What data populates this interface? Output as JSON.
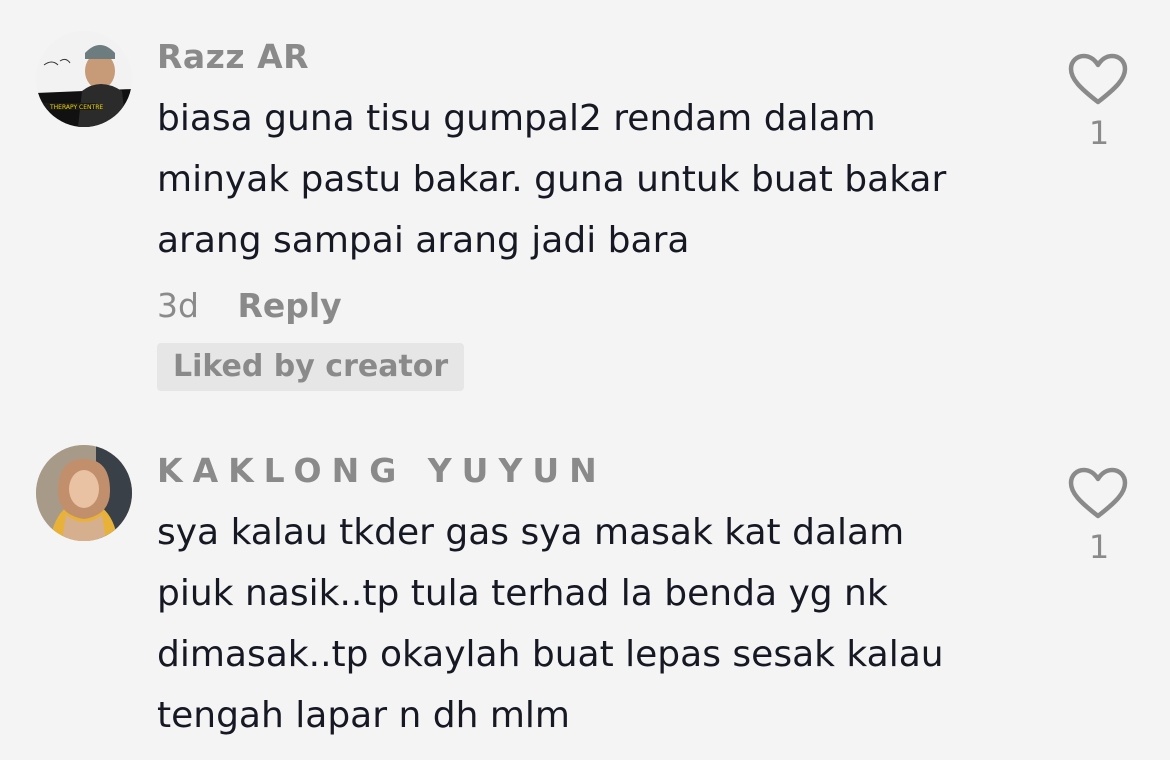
{
  "comments": [
    {
      "username": "Razz AR",
      "text_lines": [
        "biasa guna tisu gumpal2 rendam dalam",
        "minyak pastu bakar. guna untuk buat bakar",
        "arang sampai arang jadi bara"
      ],
      "time": "3d",
      "reply_label": "Reply",
      "badge": "Liked by creator",
      "like_count": "1",
      "avatar_text": "THERAPY CENTRE"
    },
    {
      "username": "KAKLONG YUYUN",
      "text_lines": [
        "sya kalau tkder gas sya masak kat dalam",
        "piuk nasik..tp tula terhad la benda yg nk",
        "dimasak..tp okaylah buat lepas sesak kalau",
        "tengah lapar n dh mlm"
      ],
      "like_count": "1"
    }
  ],
  "colors": {
    "background": "#f4f4f4",
    "text": "#161823",
    "muted": "#8a8a8a",
    "badge_bg": "#e6e6e6"
  },
  "icons": {
    "like": "heart-outline-icon"
  }
}
